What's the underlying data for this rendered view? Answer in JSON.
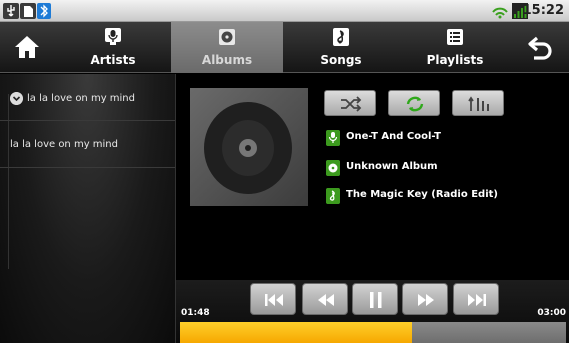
{
  "status_bar": {
    "time": "15:22",
    "icons": [
      "usb-icon",
      "sd-card-icon",
      "bluetooth-icon",
      "wifi-icon",
      "signal-icon"
    ]
  },
  "tabs": [
    {
      "label": "Artists",
      "icon": "microphone-icon",
      "active": false
    },
    {
      "label": "Albums",
      "icon": "disc-icon",
      "active": true
    },
    {
      "label": "Songs",
      "icon": "music-note-icon",
      "active": false
    },
    {
      "label": "Playlists",
      "icon": "list-icon",
      "active": false
    }
  ],
  "nav": {
    "home_icon": "home-icon",
    "back_icon": "back-arrow-icon"
  },
  "left_list": {
    "items": [
      {
        "label": "la la love on my mind",
        "expanded": true
      },
      {
        "label": "la la love on my mind",
        "expanded": false
      }
    ]
  },
  "now_playing": {
    "artist": "One-T And Cool-T",
    "album": "Unknown Album",
    "song": "The Magic Key (Radio Edit)"
  },
  "controls": {
    "shuffle": "shuffle-icon",
    "repeat": "repeat-icon",
    "equalizer": "equalizer-icon"
  },
  "transport": {
    "elapsed": "01:48",
    "total": "03:00",
    "progress": 0.6,
    "buttons": [
      "skip-previous-icon",
      "rewind-icon",
      "pause-icon",
      "fast-forward-icon",
      "skip-next-icon"
    ]
  },
  "colors": {
    "accent": "#f6b400",
    "green_icon": "#3c9a1e",
    "repeat_green": "#2fa81b"
  }
}
